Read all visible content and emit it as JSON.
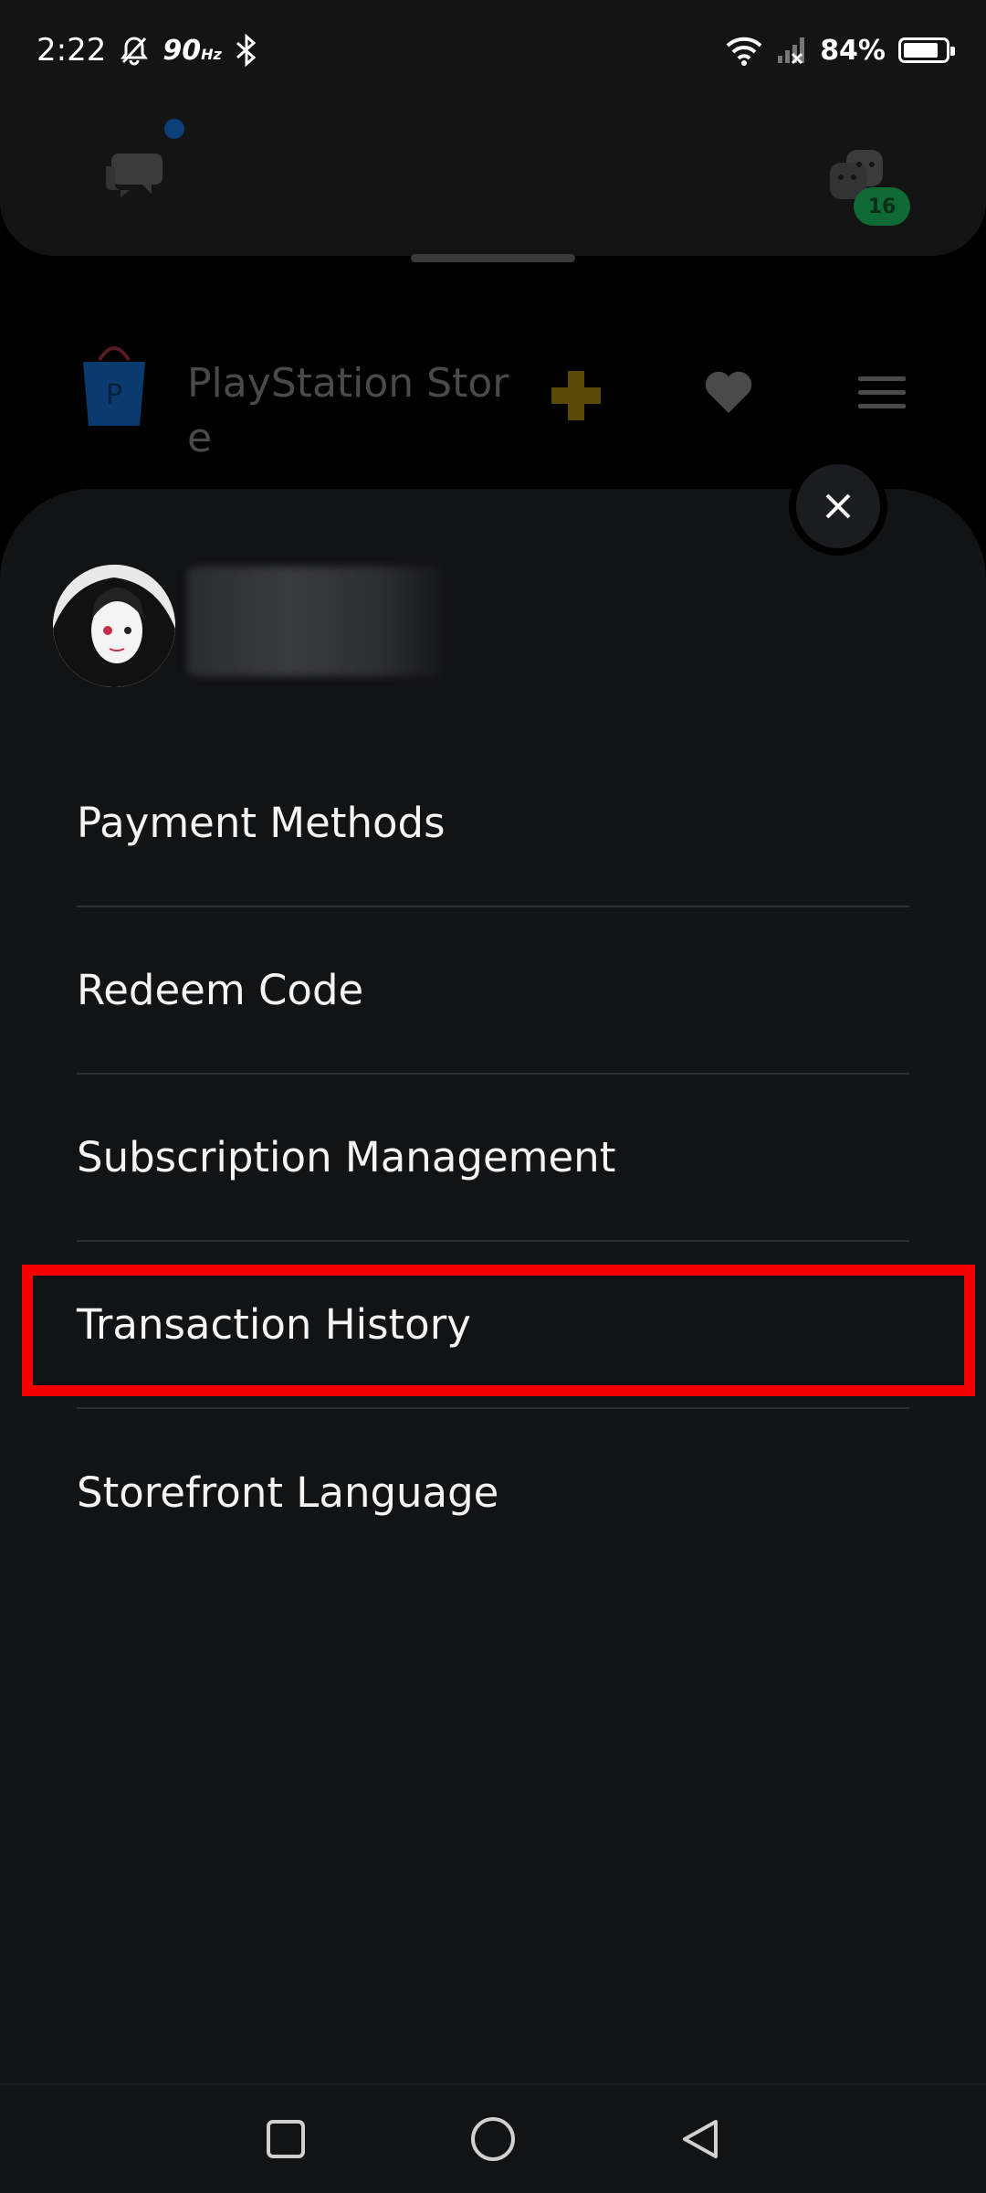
{
  "status_bar": {
    "time": "2:22",
    "refresh_rate": "90",
    "refresh_unit": "Hz",
    "battery_percent": "84%",
    "battery_level": 0.84
  },
  "background_app": {
    "friends_badge_count": "16",
    "store_title": "PlayStation Store",
    "colors": {
      "plus_yellow": "#5a4a0a",
      "store_blue": "#0b3a6e"
    }
  },
  "account_menu": {
    "items": [
      {
        "label": "Payment Methods"
      },
      {
        "label": "Redeem Code"
      },
      {
        "label": "Subscription Management"
      },
      {
        "label": "Transaction History",
        "highlighted": true
      },
      {
        "label": "Storefront Language"
      }
    ],
    "highlight_color": "#f50000"
  },
  "icons": {
    "close": "close-icon",
    "chat": "chat-icon",
    "friends": "friends-icon",
    "plus": "ps-plus-icon",
    "wishlist": "heart-icon",
    "menu": "hamburger-icon"
  }
}
